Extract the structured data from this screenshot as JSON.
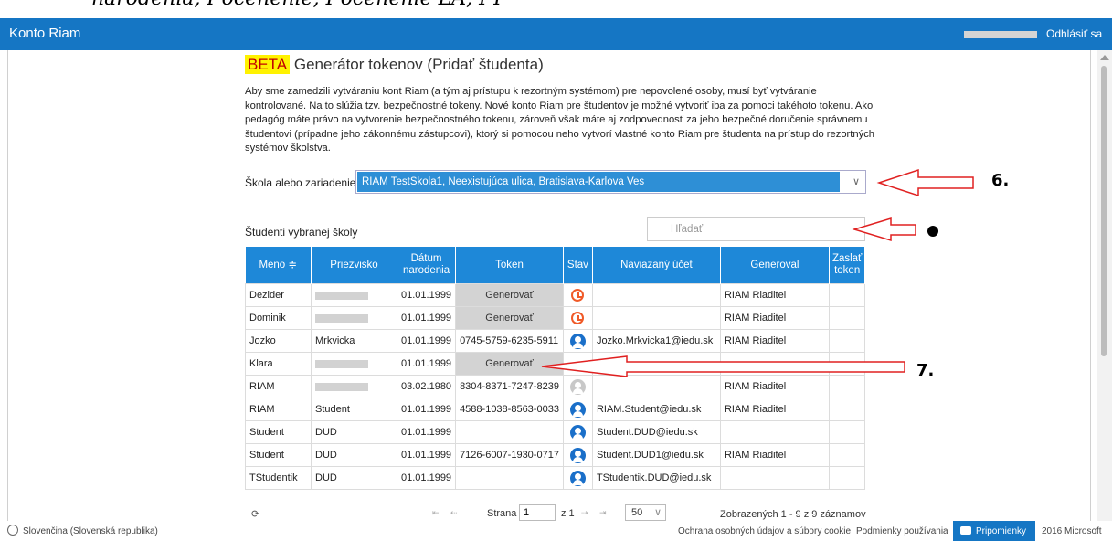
{
  "cutoff_text": "narodenia, I-ocenenie, I-ocenenie LA, I-I",
  "header": {
    "brand": "Konto Riam",
    "logout": "Odhlásiť sa"
  },
  "page": {
    "beta": "BETA",
    "title": "Generátor tokenov (Pridať študenta)",
    "description": "Aby sme zamedzili vytváraniu kont Riam (a tým aj prístupu k rezortným systémom) pre nepovolené osoby, musí byť vytváranie kontrolované. Na to slúžia tzv. bezpečnostné tokeny. Nové konto Riam pre študentov je možné vytvoriť iba za pomoci takéhoto tokenu. Ako pedagóg máte právo na vytvorenie bezpečnostného tokenu, zároveň však máte aj zodpovednosť za jeho bezpečné doručenie správnemu študentovi (prípadne jeho zákonnému zástupcovi), ktorý si pomocou neho vytvorí vlastné konto Riam pre študenta na prístup do rezortných systémov školstva.",
    "school_label": "Škola alebo zariadenie:",
    "school_value": "RIAM TestSkola1, Neexistujúca ulica, Bratislava-Karlova Ves",
    "students_title": "Študenti vybranej školy",
    "search_placeholder": "Hľadať"
  },
  "table": {
    "columns": [
      "Meno ≑",
      "Priezvisko",
      "Dátum narodenia",
      "Token",
      "Stav",
      "Naviazaný účet",
      "Generoval",
      "Zaslať token"
    ],
    "rows": [
      {
        "meno": "Dezider",
        "priezvisko": "",
        "datum": "01.01.1999",
        "token": "Generovať",
        "stav": "pending",
        "ucet": "",
        "generoval": "RIAM Riaditel"
      },
      {
        "meno": "Dominik",
        "priezvisko": "",
        "datum": "01.01.1999",
        "token": "Generovať",
        "stav": "pending",
        "ucet": "",
        "generoval": "RIAM Riaditel"
      },
      {
        "meno": "Jozko",
        "priezvisko": "Mrkvicka",
        "datum": "01.01.1999",
        "token": "0745-5759-6235-5911",
        "stav": "linked",
        "ucet": "Jozko.Mrkvicka1@iedu.sk",
        "generoval": "RIAM Riaditel"
      },
      {
        "meno": "Klara",
        "priezvisko": "",
        "datum": "01.01.1999",
        "token": "Generovať",
        "stav": "none",
        "ucet": "",
        "generoval": ""
      },
      {
        "meno": "RIAM",
        "priezvisko": "",
        "datum": "03.02.1980",
        "token": "8304-8371-7247-8239",
        "stav": "inactive",
        "ucet": "",
        "generoval": "RIAM Riaditel"
      },
      {
        "meno": "RIAM",
        "priezvisko": "Student",
        "datum": "01.01.1999",
        "token": "4588-1038-8563-0033",
        "stav": "linked",
        "ucet": "RIAM.Student@iedu.sk",
        "generoval": "RIAM Riaditel"
      },
      {
        "meno": "Student",
        "priezvisko": "DUD",
        "datum": "01.01.1999",
        "token": "",
        "stav": "linked",
        "ucet": "Student.DUD@iedu.sk",
        "generoval": ""
      },
      {
        "meno": "Student",
        "priezvisko": "DUD",
        "datum": "01.01.1999",
        "token": "7126-6007-1930-0717",
        "stav": "linked",
        "ucet": "Student.DUD1@iedu.sk",
        "generoval": "RIAM Riaditel"
      },
      {
        "meno": "TStudentik",
        "priezvisko": "DUD",
        "datum": "01.01.1999",
        "token": "",
        "stav": "linked",
        "ucet": "TStudentik.DUD@iedu.sk",
        "generoval": ""
      }
    ]
  },
  "pager": {
    "refresh": "⟳",
    "first": "⇤",
    "prev": "⇠",
    "page_label": "Strana",
    "page_value": "1",
    "of": "z 1",
    "next": "⇢",
    "last": "⇥",
    "page_size": "50",
    "records": "Zobrazených 1 - 9 z 9 záznamov"
  },
  "annotations": {
    "six": "6.",
    "seven": "7."
  },
  "footer": {
    "language": "Slovenčina (Slovenská republika)",
    "privacy": "Ochrana osobných údajov a súbory cookie",
    "terms": "Podmienky používania",
    "feedback": "Pripomienky",
    "copyright": "2016 Microsoft"
  },
  "colors": {
    "header_blue": "#1576c4",
    "table_header": "#1e88d8",
    "select_blue": "#2e8fd6",
    "pending_orange": "#f05a28",
    "beta_highlight": "#fff200",
    "arrow_red": "#e02020"
  }
}
